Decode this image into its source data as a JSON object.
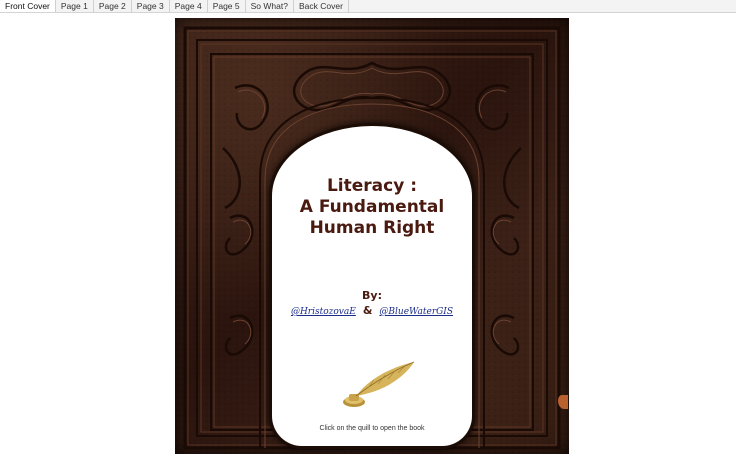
{
  "tabs": [
    {
      "label": "Front Cover",
      "active": true
    },
    {
      "label": "Page 1"
    },
    {
      "label": "Page 2"
    },
    {
      "label": "Page 3"
    },
    {
      "label": "Page 4"
    },
    {
      "label": "Page 5"
    },
    {
      "label": "So What?"
    },
    {
      "label": "Back Cover"
    }
  ],
  "cover": {
    "title_line1": "Literacy :",
    "title_line2": "A Fundamental",
    "title_line3": "Human Right",
    "by_label": "By:",
    "author1": "@HristozovaE",
    "ampersand": "&",
    "author2": "@BlueWaterGIS",
    "quill_icon": "quill-icon",
    "hint": "Click on the quill to open the book"
  },
  "colors": {
    "leather": "#2e1810",
    "title": "#4a1a10",
    "link": "#1a2b8a",
    "gold": "#c8a24a"
  }
}
